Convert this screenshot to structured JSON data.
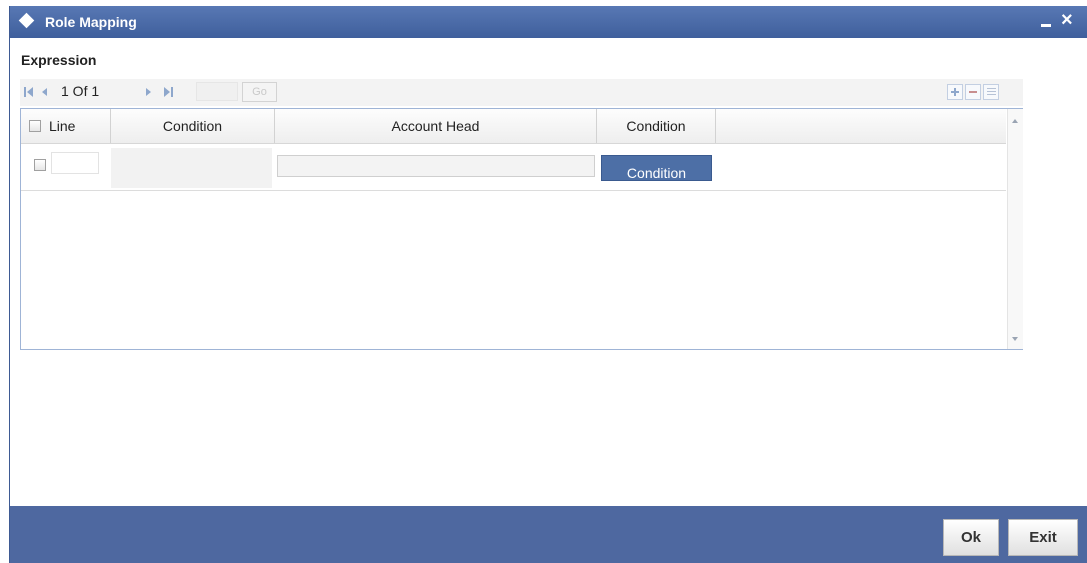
{
  "window": {
    "title": "Role Mapping",
    "minimize_label": "",
    "close_label": "×"
  },
  "section": {
    "title": "Expression"
  },
  "pager": {
    "text": "1 Of 1",
    "page_value": "",
    "go_label": "Go"
  },
  "grid": {
    "columns": [
      "Line",
      "Condition",
      "Account Head",
      "Condition"
    ],
    "rows": [
      {
        "line": "",
        "condition": "",
        "account_head": "",
        "condition_button": "Condition"
      }
    ]
  },
  "footer": {
    "ok_label": "Ok",
    "exit_label": "Exit"
  },
  "colors": {
    "titlebar": "#4a6aa8",
    "footer": "#4e68a0",
    "condition_button": "#4d6fa6"
  }
}
